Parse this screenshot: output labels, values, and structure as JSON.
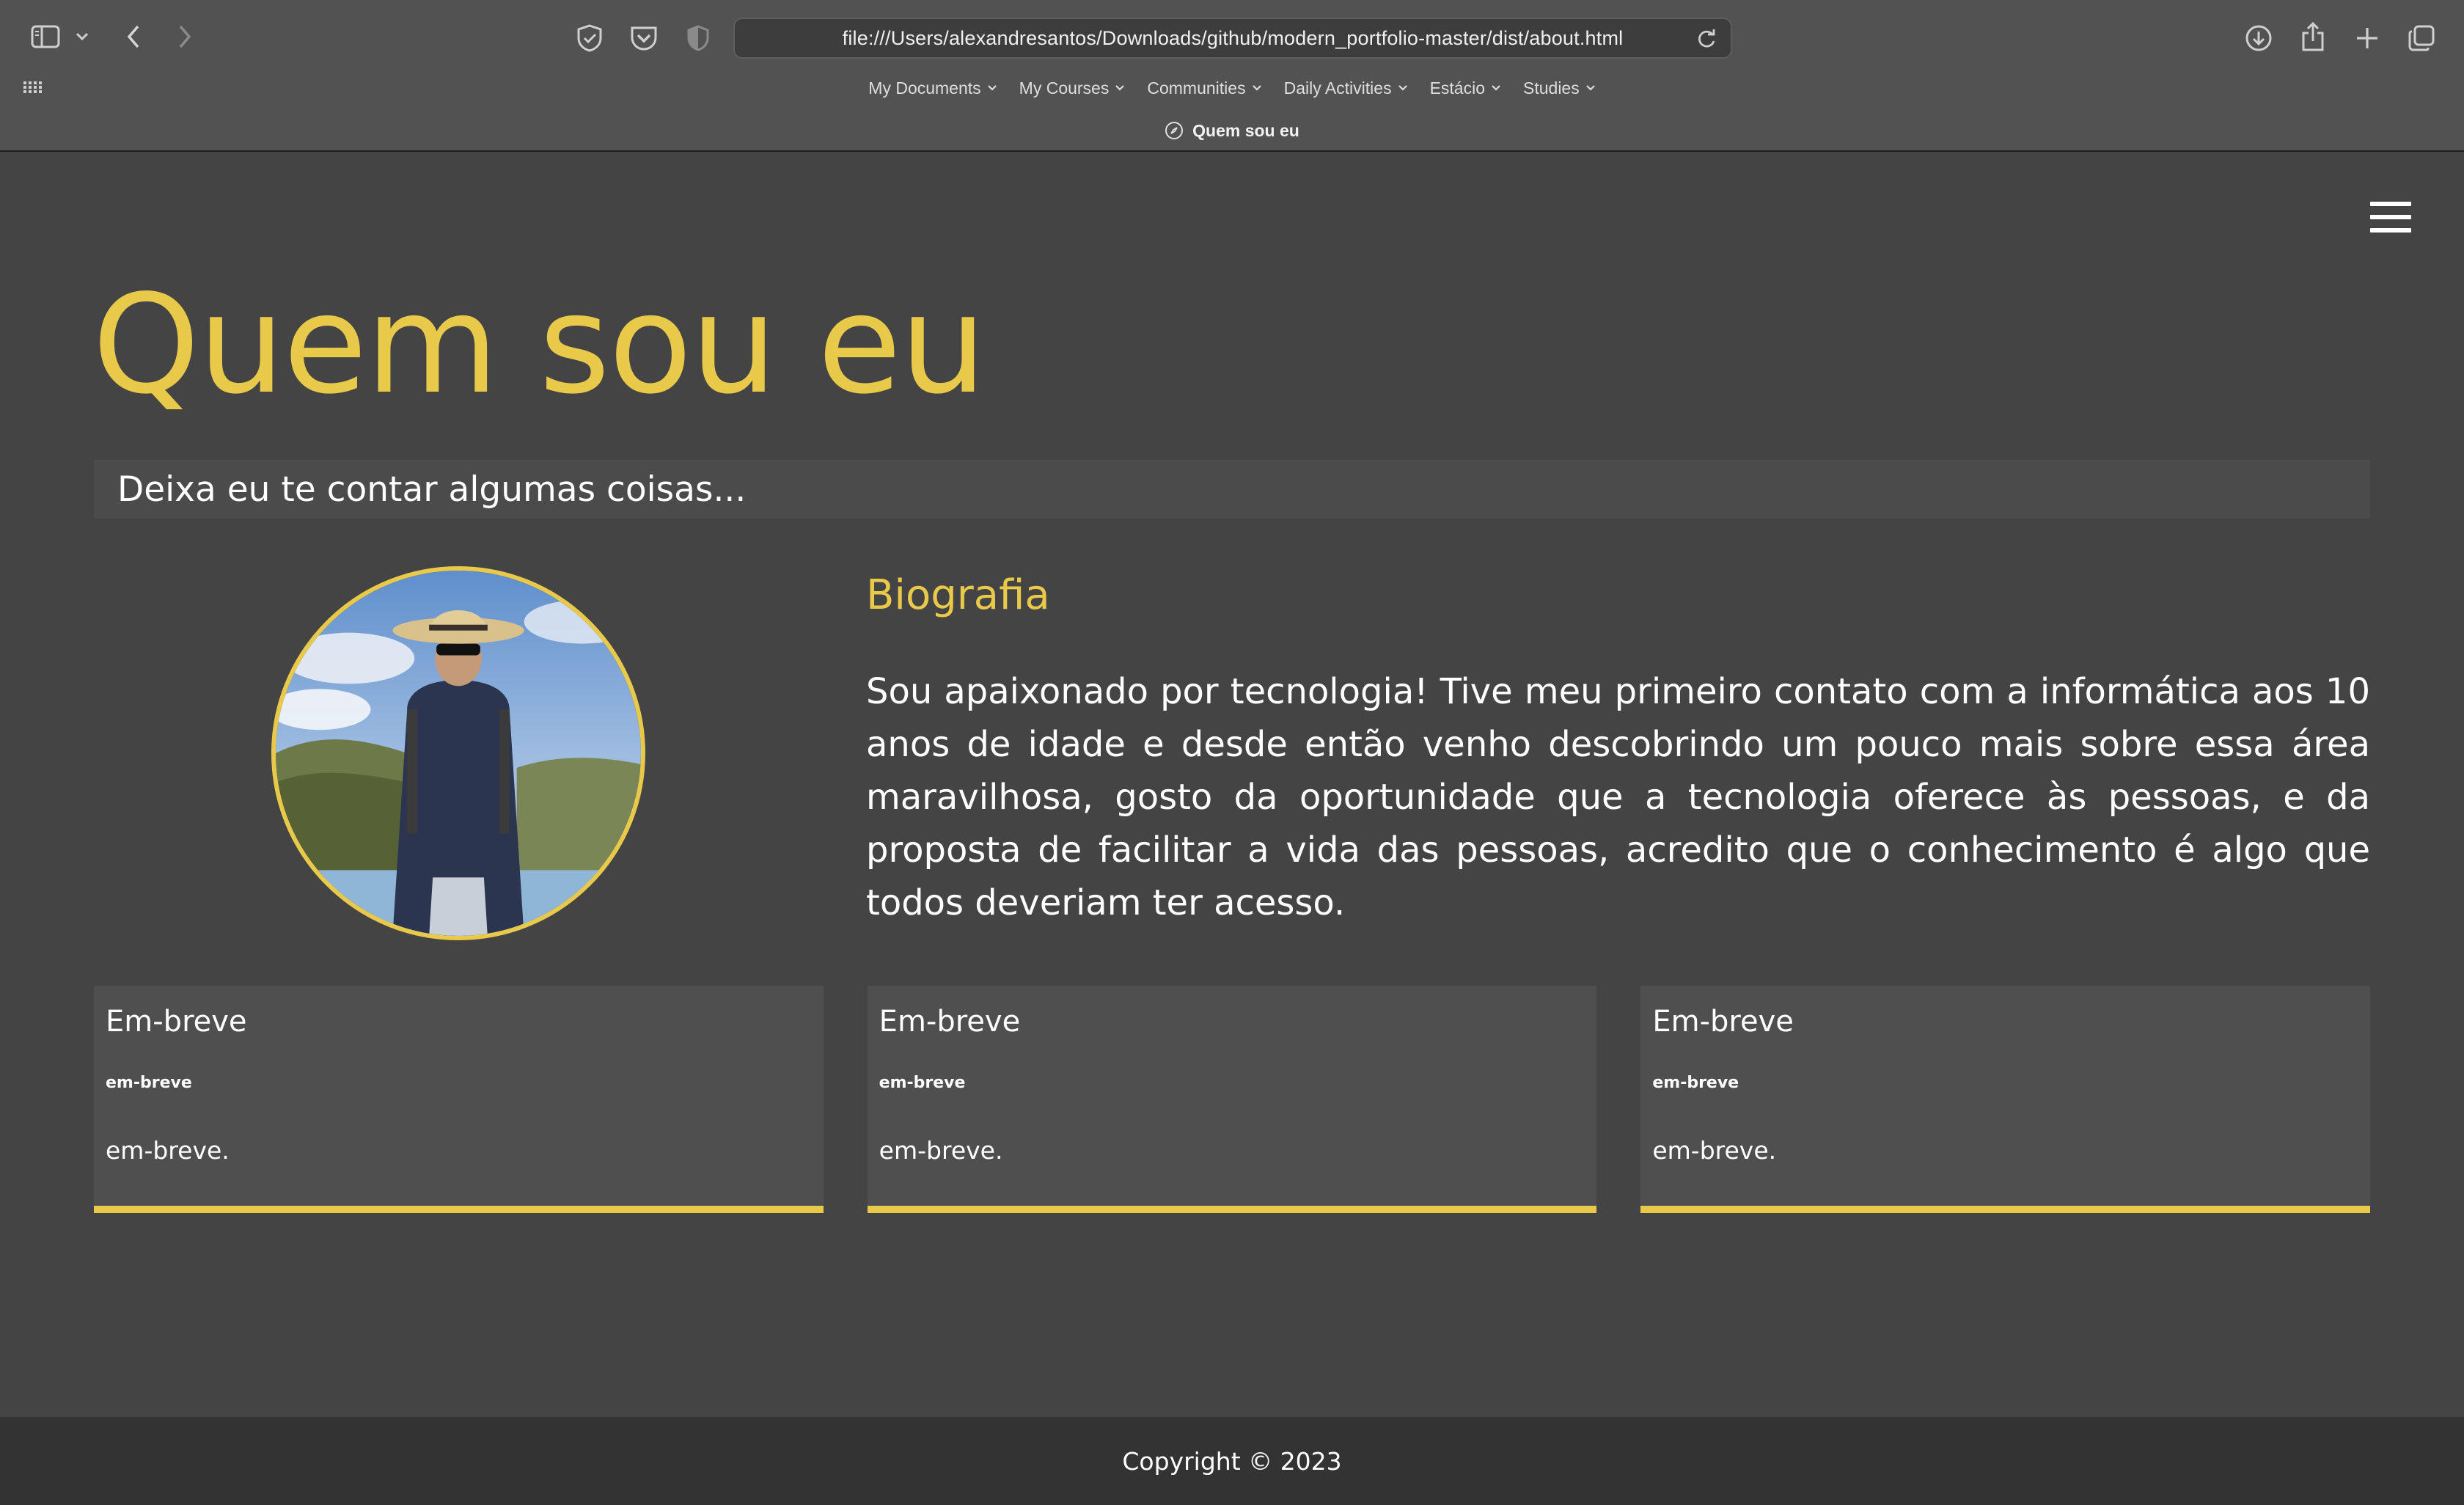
{
  "browser": {
    "url": "file:///Users/alexandresantos/Downloads/github/modern_portfolio-master/dist/about.html",
    "tab_title": "Quem sou eu",
    "favorites": [
      {
        "label": "My Documents"
      },
      {
        "label": "My Courses"
      },
      {
        "label": "Communities"
      },
      {
        "label": "Daily Activities"
      },
      {
        "label": "Estácio"
      },
      {
        "label": "Studies"
      }
    ],
    "icons": {
      "sidebar": "sidebar-toggle-icon",
      "back": "chevron-left-icon",
      "forward": "chevron-right-icon",
      "shield": "shield-check-icon",
      "pocket": "pocket-icon",
      "privacy": "half-shield-icon",
      "reload": "reload-icon",
      "downloads": "download-icon",
      "share": "share-icon",
      "new_tab": "plus-icon",
      "tabs": "tabs-overview-icon",
      "grid": "apps-grid-icon",
      "tab_favicon": "compass-icon"
    }
  },
  "page": {
    "title": "Quem sou eu",
    "subtitle": "Deixa eu te contar algumas coisas...",
    "bio": {
      "heading": "Biografia",
      "text": "Sou apaixonado por tecnologia! Tive meu primeiro contato com a informática aos 10 anos de idade e desde então venho descobrindo um pouco mais sobre essa área maravilhosa, gosto da oportunidade que a tecnologia oferece às pessoas, e da proposta de facilitar a vida das pessoas, acredito que o conhecimento é algo que todos deveriam ter acesso."
    },
    "cards": [
      {
        "title": "Em-breve",
        "subtitle": "em-breve",
        "text": "em-breve."
      },
      {
        "title": "Em-breve",
        "subtitle": "em-breve",
        "text": "em-breve."
      },
      {
        "title": "Em-breve",
        "subtitle": "em-breve",
        "text": "em-breve."
      }
    ],
    "footer": "Copyright © 2023"
  },
  "colors": {
    "accent": "#e9c94a",
    "background": "#444444",
    "footer": "#333333",
    "card": "#4f4f4f"
  }
}
